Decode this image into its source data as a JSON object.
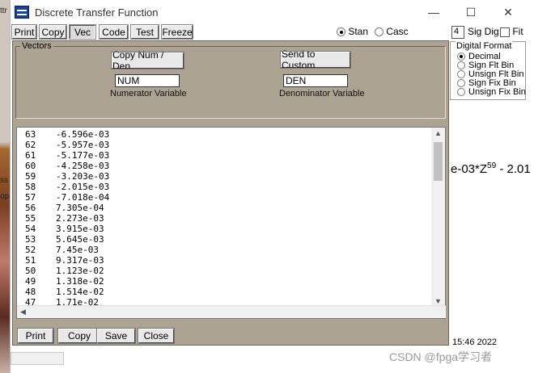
{
  "window": {
    "title": "Discrete Transfer Function",
    "controls": {
      "minimize": "—",
      "maximize": "☐",
      "close": "✕"
    }
  },
  "toolbar": {
    "buttons": [
      "Print",
      "Copy",
      "Vec",
      "Code",
      "Test",
      "Freeze"
    ],
    "pressed": "Vec",
    "structure": {
      "stan_label": "Stan",
      "casc_label": "Casc",
      "selected": "Stan"
    },
    "sig_dig_value": "4",
    "sig_dig_label": "Sig Dig",
    "fit_label": "Fit"
  },
  "digital_format": {
    "title": "Digital Format",
    "options": [
      "Decimal",
      "Sign Flt Bin",
      "Unsign Flt Bin",
      "Sign Fix Bin",
      "Unsign Fix Bin"
    ],
    "selected": "Decimal"
  },
  "background": {
    "equation_text": "e-03*Z",
    "equation_exponent": "59",
    "equation_tail": " - 2.01",
    "clock": "15:46 2022",
    "left_strip_text_1": "ttr",
    "left_strip_text_2": "ss",
    "left_strip_text_3": "op",
    "watermark": "CSDN @fpga学习者"
  },
  "vectors": {
    "group_title": "Vectors",
    "copy_button": "Copy Num / Den",
    "send_button": "Send to Custom",
    "numerator_value": "NUM",
    "numerator_caption": "Numerator Variable",
    "denominator_value": "DEN",
    "denominator_caption": "Denominator Variable",
    "rows": [
      {
        "index": "63",
        "value": "-6.596e-03"
      },
      {
        "index": "62",
        "value": "-5.957e-03"
      },
      {
        "index": "61",
        "value": "-5.177e-03"
      },
      {
        "index": "60",
        "value": "-4.258e-03"
      },
      {
        "index": "59",
        "value": "-3.203e-03"
      },
      {
        "index": "58",
        "value": "-2.015e-03"
      },
      {
        "index": "57",
        "value": "-7.018e-04"
      },
      {
        "index": "56",
        "value": "7.305e-04"
      },
      {
        "index": "55",
        "value": "2.273e-03"
      },
      {
        "index": "54",
        "value": "3.915e-03"
      },
      {
        "index": "53",
        "value": "5.645e-03"
      },
      {
        "index": "52",
        "value": "7.45e-03"
      },
      {
        "index": "51",
        "value": "9.317e-03"
      },
      {
        "index": "50",
        "value": "1.123e-02"
      },
      {
        "index": "49",
        "value": "1.318e-02"
      },
      {
        "index": "48",
        "value": "1.514e-02"
      },
      {
        "index": "47",
        "value": "1.71e-02"
      }
    ],
    "bottom_buttons": [
      "Print",
      "Copy",
      "Save",
      "Close"
    ]
  },
  "colors": {
    "dialog_bg": "#ada392",
    "app_icon": "#1d3f9c"
  }
}
